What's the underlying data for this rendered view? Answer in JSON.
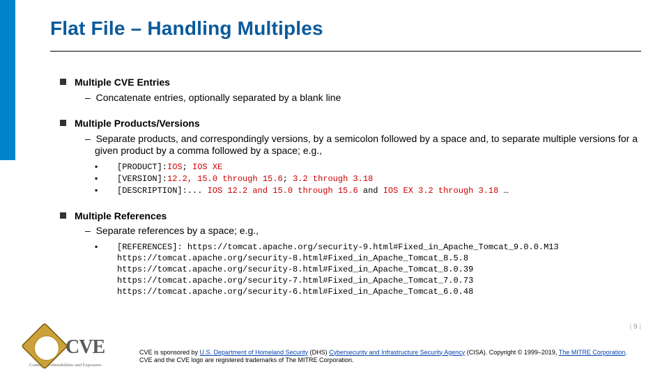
{
  "title": "Flat File – Handling Multiples",
  "sections": [
    {
      "heading": "Multiple CVE Entries",
      "sub": "Concatenate entries, optionally separated by a blank line",
      "code": []
    },
    {
      "heading": "Multiple Products/Versions",
      "sub": "Separate products, and correspondingly versions, by a semicolon followed by a space and, to separate multiple versions for a given product by a comma followed by a space; e.g.,",
      "code": [
        {
          "segments": [
            {
              "t": "[PRODUCT]:",
              "c": "blk"
            },
            {
              "t": "IOS",
              "c": "red"
            },
            {
              "t": "; ",
              "c": "blk"
            },
            {
              "t": "IOS XE",
              "c": "red"
            }
          ]
        },
        {
          "segments": [
            {
              "t": "[VERSION]:",
              "c": "blk"
            },
            {
              "t": "12.2, 15.0 through 15.6",
              "c": "red"
            },
            {
              "t": "; ",
              "c": "blk"
            },
            {
              "t": "3.2 through 3.18",
              "c": "red"
            }
          ]
        },
        {
          "segments": [
            {
              "t": "[DESCRIPTION]:... ",
              "c": "blk"
            },
            {
              "t": "IOS 12.2 and 15.0 through 15.6 ",
              "c": "red"
            },
            {
              "t": "and ",
              "c": "blk"
            },
            {
              "t": "IOS EX 3.2 through 3.18 ",
              "c": "red"
            },
            {
              "t": "…",
              "c": "blk"
            }
          ]
        }
      ]
    },
    {
      "heading": "Multiple References",
      "sub": "Separate references by a space; e.g.,",
      "code": [
        {
          "segments": [
            {
              "t": "[REFERENCES]: https://tomcat.apache.org/security-9.html#Fixed_in_Apache_Tomcat_9.0.0.M13",
              "c": "blk"
            }
          ]
        },
        {
          "nobullet": true,
          "segments": [
            {
              "t": "https://tomcat.apache.org/security-8.html#Fixed_in_Apache_Tomcat_8.5.8",
              "c": "blk"
            }
          ]
        },
        {
          "nobullet": true,
          "segments": [
            {
              "t": "https://tomcat.apache.org/security-8.html#Fixed_in_Apache_Tomcat_8.0.39",
              "c": "blk"
            }
          ]
        },
        {
          "nobullet": true,
          "segments": [
            {
              "t": "https://tomcat.apache.org/security-7.html#Fixed_in_Apache_Tomcat_7.0.73",
              "c": "blk"
            }
          ]
        },
        {
          "nobullet": true,
          "segments": [
            {
              "t": "https://tomcat.apache.org/security-6.html#Fixed_in_Apache_Tomcat_6.0.48",
              "c": "blk"
            }
          ]
        }
      ]
    }
  ],
  "logo": {
    "text": "CVE",
    "sub": "Common Vulnerabilities and Exposures"
  },
  "page_number": "9",
  "footer": {
    "prefix": "CVE is sponsored by ",
    "link1": "U.S. Department of Homeland Security",
    "mid1": " (DHS) ",
    "link2": "Cybersecurity and Infrastructure Security Agency",
    "mid2": " (CISA). Copyright © 1999–2019, ",
    "link3": "The MITRE Corporation",
    "suffix": ". CVE and the CVE logo are registered trademarks of The MITRE Corporation."
  }
}
